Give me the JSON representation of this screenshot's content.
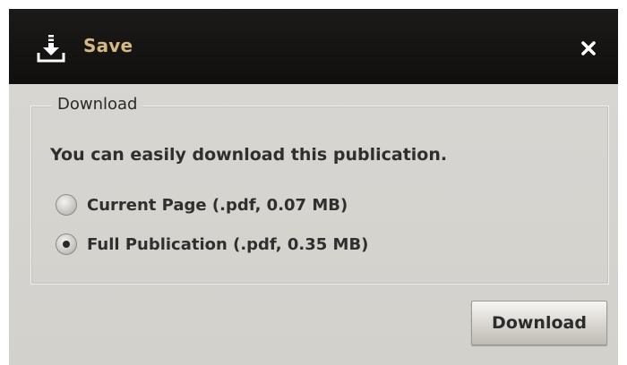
{
  "dialog": {
    "title": "Save",
    "title_color": "#d6b883",
    "icon": "download-icon",
    "close_icon": "close-icon",
    "close_glyph": "✕"
  },
  "download_group": {
    "legend": "Download",
    "intro": "You can easily download this publication.",
    "options": [
      {
        "label": "Current Page (.pdf, 0.07 MB)",
        "selected": false
      },
      {
        "label": "Full Publication (.pdf, 0.35 MB)",
        "selected": true
      }
    ]
  },
  "actions": {
    "download_label": "Download"
  }
}
